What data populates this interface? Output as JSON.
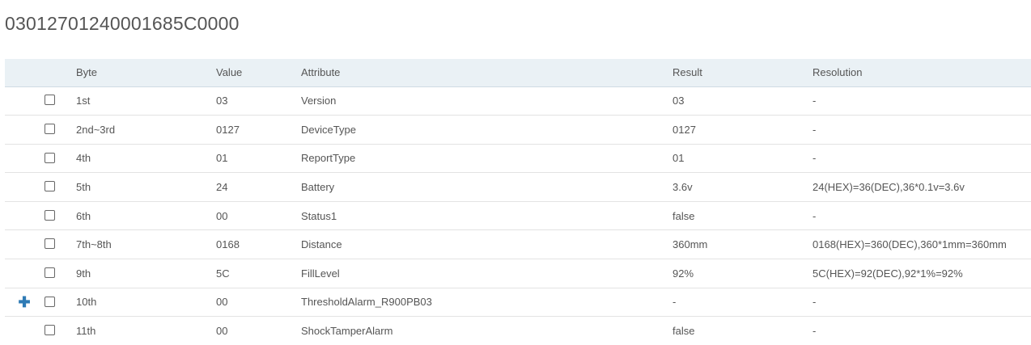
{
  "title": "03012701240001685C0000",
  "columns": {
    "byte": "Byte",
    "value": "Value",
    "attribute": "Attribute",
    "result": "Result",
    "resolution": "Resolution"
  },
  "rows": [
    {
      "byte": "1st",
      "value": "03",
      "attribute": "Version",
      "result": "03",
      "resolution": "-",
      "expandable": false
    },
    {
      "byte": "2nd~3rd",
      "value": "0127",
      "attribute": "DeviceType",
      "result": "0127",
      "resolution": "-",
      "expandable": false
    },
    {
      "byte": "4th",
      "value": "01",
      "attribute": "ReportType",
      "result": "01",
      "resolution": "-",
      "expandable": false
    },
    {
      "byte": "5th",
      "value": "24",
      "attribute": "Battery",
      "result": "3.6v",
      "resolution": "24(HEX)=36(DEC),36*0.1v=3.6v",
      "expandable": false
    },
    {
      "byte": "6th",
      "value": "00",
      "attribute": "Status1",
      "result": "false",
      "resolution": "-",
      "expandable": false
    },
    {
      "byte": "7th~8th",
      "value": "0168",
      "attribute": "Distance",
      "result": "360mm",
      "resolution": "0168(HEX)=360(DEC),360*1mm=360mm",
      "expandable": false
    },
    {
      "byte": "9th",
      "value": "5C",
      "attribute": "FillLevel",
      "result": "92%",
      "resolution": "5C(HEX)=92(DEC),92*1%=92%",
      "expandable": false
    },
    {
      "byte": "10th",
      "value": "00",
      "attribute": "ThresholdAlarm_R900PB03",
      "result": "-",
      "resolution": "-",
      "expandable": true
    },
    {
      "byte": "11th",
      "value": "00",
      "attribute": "ShockTamperAlarm",
      "result": "false",
      "resolution": "-",
      "expandable": false
    }
  ],
  "icons": {
    "expand": "plus-icon"
  },
  "colors": {
    "header_bg": "#eaf1f5",
    "expand_icon": "#2f7bb5"
  }
}
